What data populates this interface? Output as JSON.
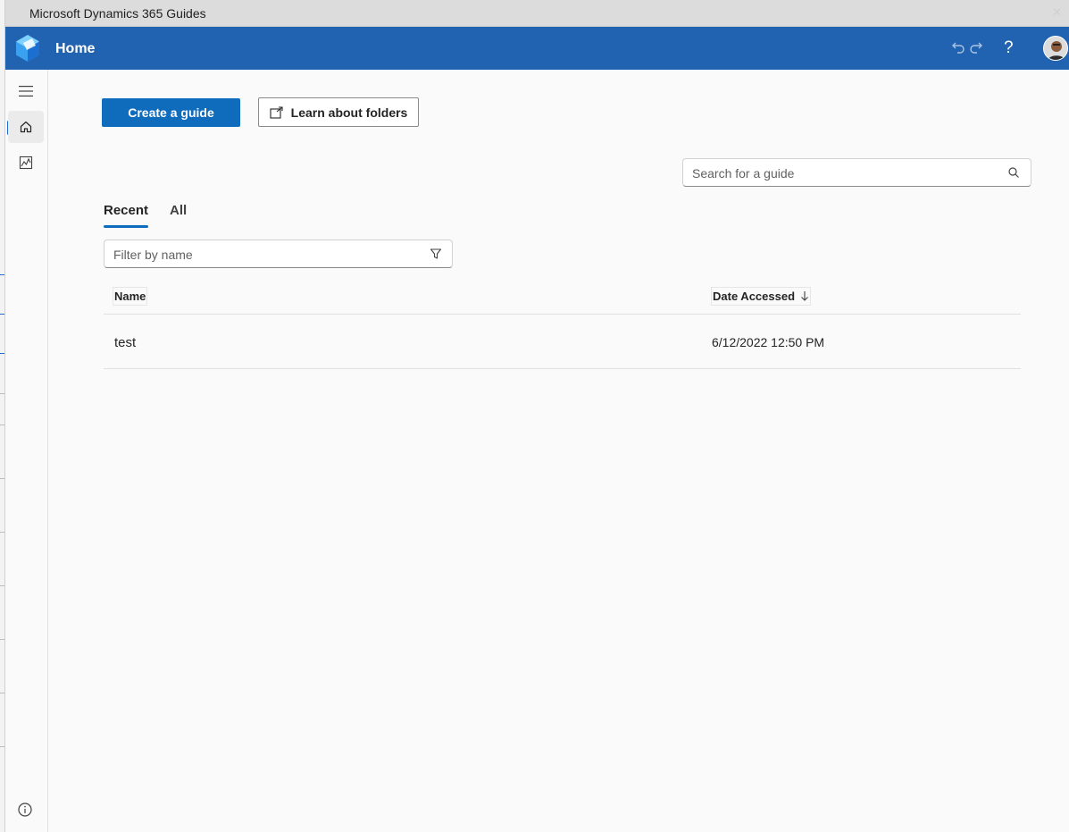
{
  "window": {
    "title": "Microsoft Dynamics 365 Guides"
  },
  "header": {
    "page_title": "Home",
    "undo_icon": "undo-icon",
    "redo_icon": "redo-icon",
    "help_label": "?",
    "brand_color": "#2163b0"
  },
  "rail": {
    "items": [
      {
        "icon": "hamburger-menu-icon"
      },
      {
        "icon": "home-icon",
        "active": true
      },
      {
        "icon": "analytics-icon"
      },
      {
        "icon": "info-icon"
      }
    ]
  },
  "actions": {
    "create_label": "Create a guide",
    "learn_label": "Learn about folders"
  },
  "search": {
    "placeholder": "Search for a guide"
  },
  "tabs": [
    {
      "label": "Recent",
      "selected": true
    },
    {
      "label": "All",
      "selected": false
    }
  ],
  "filter": {
    "placeholder": "Filter by name"
  },
  "table": {
    "columns": [
      {
        "label": "Name"
      },
      {
        "label": "Date Accessed",
        "sort": "descending"
      }
    ],
    "rows": [
      {
        "name": "test",
        "date_accessed": "6/12/2022 12:50 PM"
      }
    ]
  },
  "colors": {
    "accent": "#0f6cbd",
    "header": "#2163b0"
  }
}
